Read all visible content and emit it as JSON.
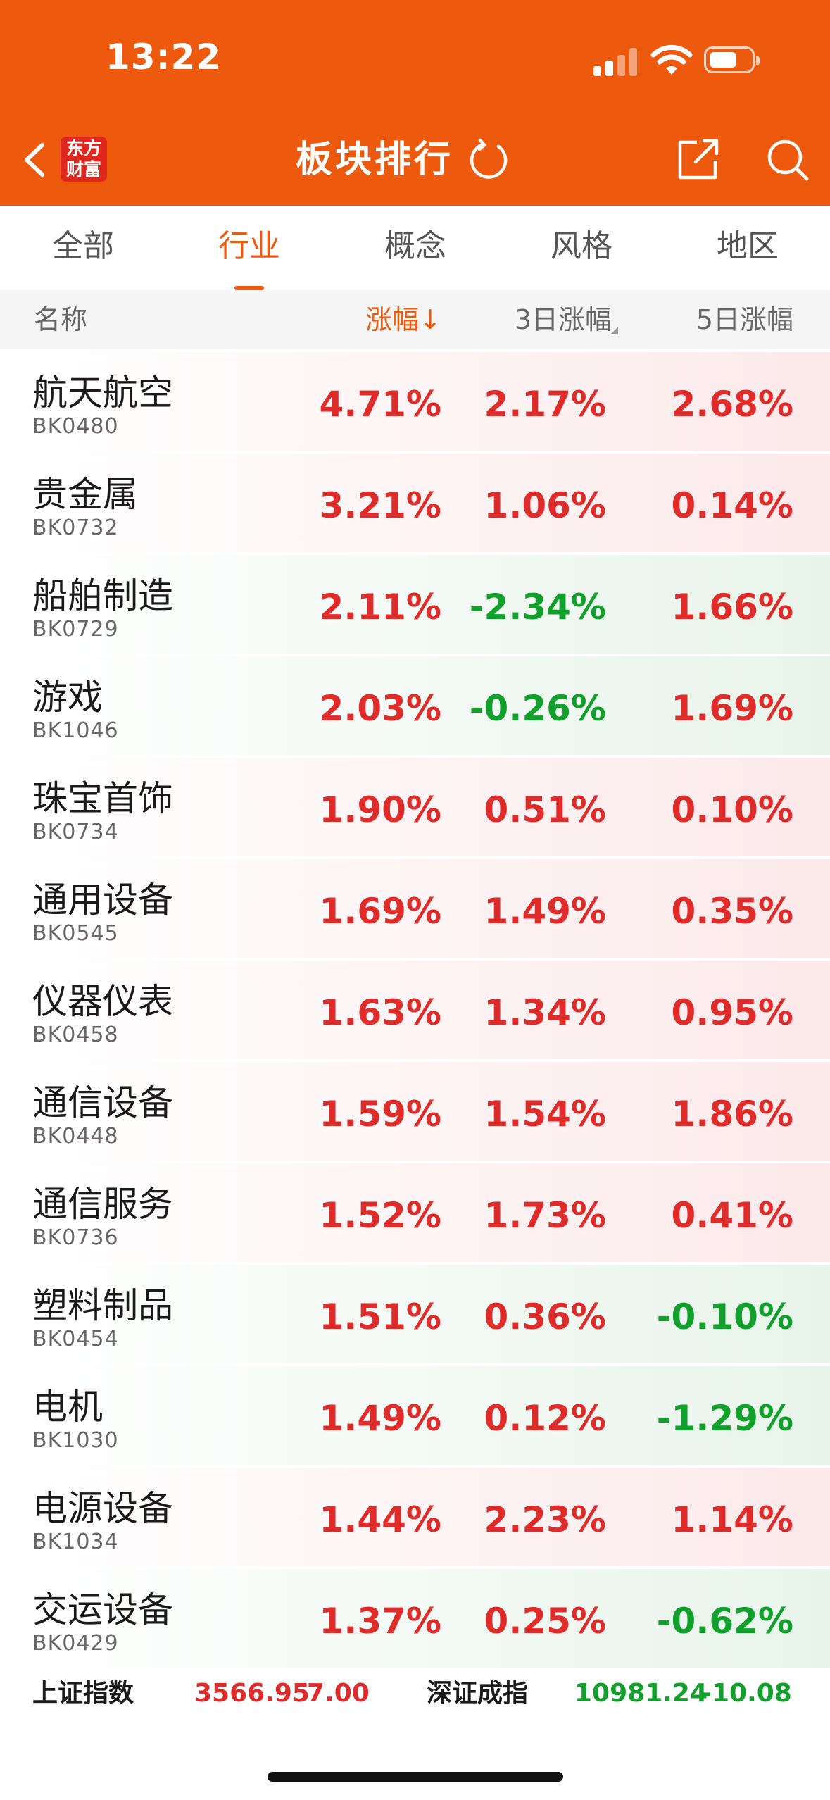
{
  "status_bar": {
    "time": "13:22"
  },
  "header": {
    "logo_line1": "东方",
    "logo_line2": "财富",
    "title": "板块排行",
    "icons": [
      "back-arrow-icon",
      "refresh-icon",
      "share-icon",
      "search-icon"
    ]
  },
  "tabs": [
    {
      "label": "全部",
      "active": false
    },
    {
      "label": "行业",
      "active": true
    },
    {
      "label": "概念",
      "active": false
    },
    {
      "label": "风格",
      "active": false
    },
    {
      "label": "地区",
      "active": false
    }
  ],
  "columns": {
    "name": "名称",
    "change": "涨幅↓",
    "change_3d": "3日涨幅",
    "change_5d": "5日涨幅"
  },
  "rows": [
    {
      "name": "航天航空",
      "code": "BK0480",
      "chg": "4.71%",
      "chg3": "2.17%",
      "chg5": "2.68%"
    },
    {
      "name": "贵金属",
      "code": "BK0732",
      "chg": "3.21%",
      "chg3": "1.06%",
      "chg5": "0.14%"
    },
    {
      "name": "船舶制造",
      "code": "BK0729",
      "chg": "2.11%",
      "chg3": "-2.34%",
      "chg5": "1.66%"
    },
    {
      "name": "游戏",
      "code": "BK1046",
      "chg": "2.03%",
      "chg3": "-0.26%",
      "chg5": "1.69%"
    },
    {
      "name": "珠宝首饰",
      "code": "BK0734",
      "chg": "1.90%",
      "chg3": "0.51%",
      "chg5": "0.10%"
    },
    {
      "name": "通用设备",
      "code": "BK0545",
      "chg": "1.69%",
      "chg3": "1.49%",
      "chg5": "0.35%"
    },
    {
      "name": "仪器仪表",
      "code": "BK0458",
      "chg": "1.63%",
      "chg3": "1.34%",
      "chg5": "0.95%"
    },
    {
      "name": "通信设备",
      "code": "BK0448",
      "chg": "1.59%",
      "chg3": "1.54%",
      "chg5": "1.86%"
    },
    {
      "name": "通信服务",
      "code": "BK0736",
      "chg": "1.52%",
      "chg3": "1.73%",
      "chg5": "0.41%"
    },
    {
      "name": "塑料制品",
      "code": "BK0454",
      "chg": "1.51%",
      "chg3": "0.36%",
      "chg5": "-0.10%"
    },
    {
      "name": "电机",
      "code": "BK1030",
      "chg": "1.49%",
      "chg3": "0.12%",
      "chg5": "-1.29%"
    },
    {
      "name": "电源设备",
      "code": "BK1034",
      "chg": "1.44%",
      "chg3": "2.23%",
      "chg5": "1.14%"
    },
    {
      "name": "交运设备",
      "code": "BK0429",
      "chg": "1.37%",
      "chg3": "0.25%",
      "chg5": "-0.62%"
    }
  ],
  "index_bar": {
    "sh_label": "上证指数",
    "sh_value": "3566.95",
    "sh_change": "7.00",
    "sz_label": "深证成指",
    "sz_value": "10981.24",
    "sz_change": "-10.08"
  },
  "colors": {
    "brand": "#ED5A0E",
    "up": "#E02B2B",
    "down": "#12A02C"
  }
}
